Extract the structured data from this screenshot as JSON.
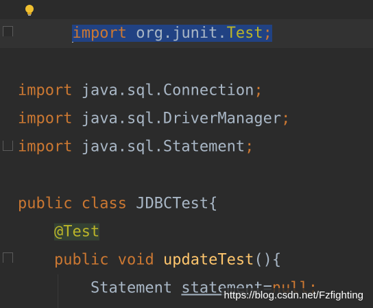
{
  "editor": {
    "intention_icon": "lightbulb-icon",
    "lines": [
      {
        "parts": [
          {
            "t": "import",
            "c": "kw"
          },
          {
            "t": " org.junit.",
            "c": "pl"
          },
          {
            "t": "Test",
            "c": "ann"
          },
          {
            "t": ";",
            "c": "kw"
          }
        ]
      },
      {
        "parts": []
      },
      {
        "parts": [
          {
            "t": "import",
            "c": "kw"
          },
          {
            "t": " java.sql.Connection",
            "c": "pl"
          },
          {
            "t": ";",
            "c": "kw"
          }
        ]
      },
      {
        "parts": [
          {
            "t": "import",
            "c": "kw"
          },
          {
            "t": " java.sql.DriverManager",
            "c": "pl"
          },
          {
            "t": ";",
            "c": "kw"
          }
        ]
      },
      {
        "parts": [
          {
            "t": "import",
            "c": "kw"
          },
          {
            "t": " java.sql.Statement",
            "c": "pl"
          },
          {
            "t": ";",
            "c": "kw"
          }
        ]
      },
      {
        "parts": []
      },
      {
        "parts": [
          {
            "t": "public",
            "c": "kw"
          },
          {
            "t": " ",
            "c": "pl"
          },
          {
            "t": "class",
            "c": "kw"
          },
          {
            "t": " JDBCTest{",
            "c": "pl"
          }
        ]
      },
      {
        "parts": [
          {
            "t": "    ",
            "c": "pl"
          },
          {
            "t": "@Test",
            "c": "ann"
          }
        ]
      },
      {
        "parts": [
          {
            "t": "    ",
            "c": "pl"
          },
          {
            "t": "public",
            "c": "kw"
          },
          {
            "t": " ",
            "c": "pl"
          },
          {
            "t": "void",
            "c": "kw"
          },
          {
            "t": " ",
            "c": "pl"
          },
          {
            "t": "updateTest",
            "c": "fn"
          },
          {
            "t": "(){",
            "c": "pl"
          }
        ]
      },
      {
        "parts": [
          {
            "t": "        Statement ",
            "c": "pl"
          },
          {
            "t": "statement",
            "c": "pl"
          },
          {
            "t": "=",
            "c": "pl"
          },
          {
            "t": "null",
            "c": "kw"
          },
          {
            "t": ";",
            "c": "kw"
          }
        ]
      }
    ]
  },
  "watermark": "https://blog.csdn.net/Fzfighting",
  "colors": {
    "background": "#2b2b2b",
    "keyword": "#cc7832",
    "plain": "#a9b7c6",
    "annotation": "#bbb529",
    "method": "#ffc66d",
    "selection": "#214283"
  }
}
